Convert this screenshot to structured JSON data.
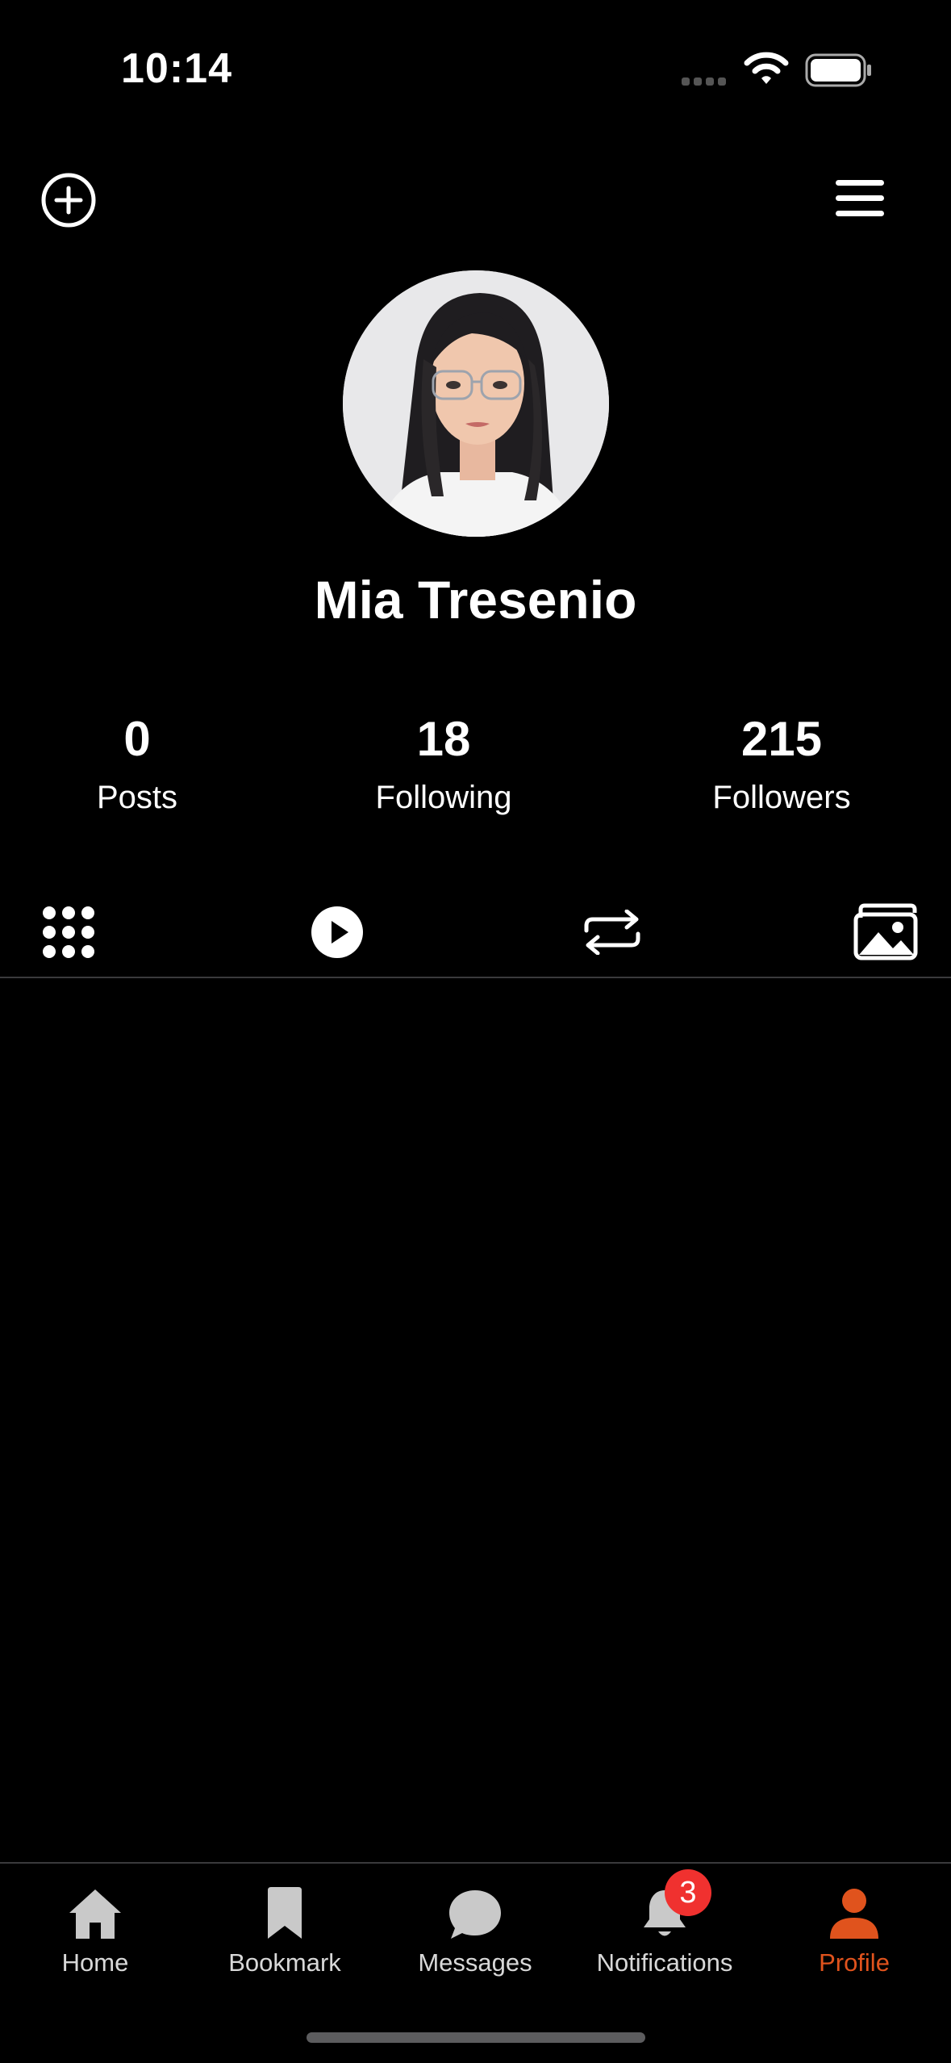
{
  "status_bar": {
    "time": "10:14"
  },
  "profile": {
    "name": "Mia Tresenio",
    "stats": [
      {
        "value": "0",
        "label": "Posts"
      },
      {
        "value": "18",
        "label": "Following"
      },
      {
        "value": "215",
        "label": "Followers"
      }
    ]
  },
  "tabs": [
    {
      "icon": "grid-icon",
      "selected": true
    },
    {
      "icon": "play-icon"
    },
    {
      "icon": "repost-icon"
    },
    {
      "icon": "photos-icon"
    }
  ],
  "nav": {
    "items": [
      {
        "label": "Home",
        "icon": "home-icon"
      },
      {
        "label": "Bookmark",
        "icon": "bookmark-icon"
      },
      {
        "label": "Messages",
        "icon": "message-icon"
      },
      {
        "label": "Notifications",
        "icon": "bell-icon",
        "badge": "3"
      },
      {
        "label": "Profile",
        "icon": "person-icon",
        "active": true
      }
    ]
  },
  "colors": {
    "accent": "#e0531d",
    "badge": "#f0312f",
    "background": "#000000"
  }
}
